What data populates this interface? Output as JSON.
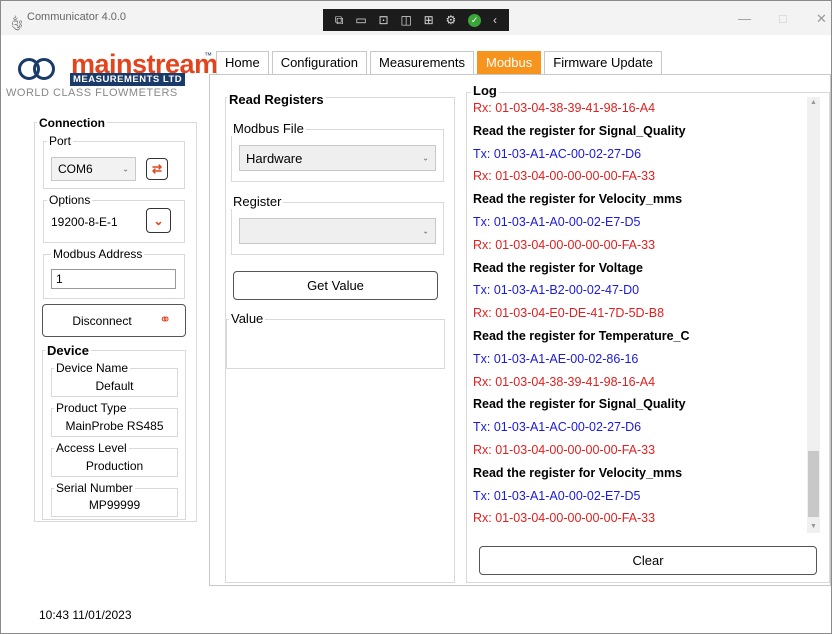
{
  "window": {
    "title": "Communicator 4.0.0",
    "title_icon": "༂",
    "minimize": "—",
    "maximize": "□",
    "close": "✕"
  },
  "logo": {
    "brand": "mainstream",
    "trademark": "™",
    "sub": "MEASUREMENTS LTD",
    "tagline": "WORLD CLASS FLOWMETERS"
  },
  "connection": {
    "heading": "Connection",
    "port_label": "Port",
    "port_value": "COM6",
    "options_label": "Options",
    "options_value": "19200-8-E-1",
    "modbus_address_label": "Modbus Address",
    "modbus_address_value": "1",
    "disconnect_label": "Disconnect"
  },
  "device": {
    "heading": "Device",
    "name_label": "Device Name",
    "name_value": "Default",
    "type_label": "Product Type",
    "type_value": "MainProbe RS485",
    "access_label": "Access Level",
    "access_value": "Production",
    "serial_label": "Serial Number",
    "serial_value": "MP99999"
  },
  "tabs": [
    "Home",
    "Configuration",
    "Measurements",
    "Modbus",
    "Firmware Update"
  ],
  "active_tab": "Modbus",
  "read_registers": {
    "heading": "Read Registers",
    "modbus_file_label": "Modbus File",
    "modbus_file_value": "Hardware",
    "register_label": "Register",
    "register_value": "",
    "get_value_label": "Get Value",
    "value_label": "Value"
  },
  "log": {
    "heading": "Log",
    "clear_label": "Clear",
    "lines": [
      {
        "kind": "rx",
        "text": "Rx: 01-03-04-38-39-41-98-16-A4"
      },
      {
        "kind": "head",
        "text": "Read the register for Signal_Quality"
      },
      {
        "kind": "tx",
        "text": "Tx: 01-03-A1-AC-00-02-27-D6"
      },
      {
        "kind": "rx",
        "text": "Rx: 01-03-04-00-00-00-00-FA-33"
      },
      {
        "kind": "head",
        "text": "Read the register for Velocity_mms"
      },
      {
        "kind": "tx",
        "text": "Tx: 01-03-A1-A0-00-02-E7-D5"
      },
      {
        "kind": "rx",
        "text": "Rx: 01-03-04-00-00-00-00-FA-33"
      },
      {
        "kind": "head",
        "text": "Read the register for Voltage"
      },
      {
        "kind": "tx",
        "text": "Tx: 01-03-A1-B2-00-02-47-D0"
      },
      {
        "kind": "rx",
        "text": "Rx: 01-03-04-E0-DE-41-7D-5D-B8"
      },
      {
        "kind": "head",
        "text": "Read the register for Temperature_C"
      },
      {
        "kind": "tx",
        "text": "Tx: 01-03-A1-AE-00-02-86-16"
      },
      {
        "kind": "rx",
        "text": "Rx: 01-03-04-38-39-41-98-16-A4"
      },
      {
        "kind": "head",
        "text": "Read the register for Signal_Quality"
      },
      {
        "kind": "tx",
        "text": "Tx: 01-03-A1-AC-00-02-27-D6"
      },
      {
        "kind": "rx",
        "text": "Rx: 01-03-04-00-00-00-00-FA-33"
      },
      {
        "kind": "head",
        "text": "Read the register for Velocity_mms"
      },
      {
        "kind": "tx",
        "text": "Tx: 01-03-A1-A0-00-02-E7-D5"
      },
      {
        "kind": "rx",
        "text": "Rx: 01-03-04-00-00-00-00-FA-33"
      }
    ]
  },
  "status": {
    "datetime": "10:43 11/01/2023"
  },
  "colors": {
    "accent_orange": "#f7941d",
    "brand_orange": "#e2451e",
    "brand_navy": "#1a3a6a",
    "rx_red": "#e02020",
    "tx_blue": "#1a1ad8"
  },
  "icons": {
    "refresh": "refresh-icon",
    "dropdown": "chevron-down-icon",
    "disconnect": "link-icon"
  }
}
